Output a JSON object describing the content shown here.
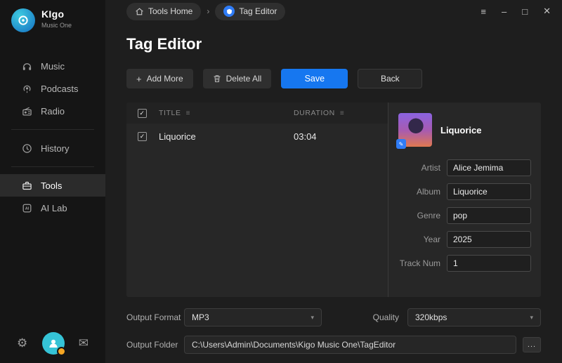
{
  "app": {
    "name": "KIgo",
    "tagline": "Music One"
  },
  "sidebar": {
    "items": [
      {
        "label": "Music",
        "icon": "headphones-icon"
      },
      {
        "label": "Podcasts",
        "icon": "podcast-icon"
      },
      {
        "label": "Radio",
        "icon": "radio-icon"
      },
      {
        "label": "History",
        "icon": "history-icon"
      },
      {
        "label": "Tools",
        "icon": "tools-icon",
        "active": true
      },
      {
        "label": "AI Lab",
        "icon": "ai-lab-icon"
      }
    ]
  },
  "breadcrumb": {
    "home": "Tools Home",
    "separator": "›",
    "current": "Tag Editor"
  },
  "window_controls": {
    "menu": "≡",
    "minimize": "–",
    "maximize": "□",
    "close": "✕"
  },
  "page": {
    "title": "Tag Editor"
  },
  "toolbar": {
    "add_more": "Add More",
    "delete_all": "Delete All",
    "save": "Save",
    "back": "Back"
  },
  "table": {
    "columns": [
      "TITLE",
      "DURATION"
    ],
    "rows": [
      {
        "checked": true,
        "title": "Liquorice",
        "duration": "03:04"
      }
    ]
  },
  "detail": {
    "title": "Liquorice",
    "fields": [
      {
        "label": "Artist",
        "value": "Alice Jemima"
      },
      {
        "label": "Album",
        "value": "Liquorice"
      },
      {
        "label": "Genre",
        "value": "pop"
      },
      {
        "label": "Year",
        "value": "2025"
      },
      {
        "label": "Track Num",
        "value": "1"
      }
    ]
  },
  "footer": {
    "output_format_label": "Output Format",
    "output_format_value": "MP3",
    "quality_label": "Quality",
    "quality_value": "320kbps",
    "output_folder_label": "Output Folder",
    "output_folder_value": "C:\\Users\\Admin\\Documents\\Kigo Music One\\TagEditor",
    "browse": "..."
  },
  "icons": {
    "plus": "+",
    "sort": "≡",
    "check": "✓",
    "chevron": "▾",
    "gear": "⚙",
    "mail": "✉",
    "edit": "✎"
  },
  "colors": {
    "accent": "#1677f0",
    "sidebar_active": "#2b2b2b",
    "avatar": "#35c3d6",
    "badge": "#f5a623"
  }
}
